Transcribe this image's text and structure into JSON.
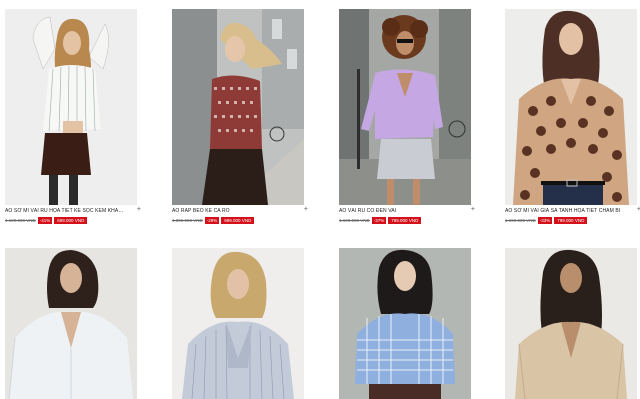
{
  "products": [
    {
      "name": "ÁO SƠ MI VẢI RŨ HỌA TIẾT KẺ SỌC KÈM KHĂN QUÀ...",
      "old_price": "1.199.000 VND",
      "discount": "-41%",
      "price": "699.000 VND"
    },
    {
      "name": "ÁO RÁP BÈO KẺ CA RÔ",
      "old_price": "1.399.000 VND",
      "discount": "-29%",
      "price": "999.000 VND"
    },
    {
      "name": "ÁO VẢI RŨ CỔ ĐÈN VAI",
      "old_price": "1.199.000 VND",
      "discount": "-37%",
      "price": "799.000 VND"
    },
    {
      "name": "ÁO SƠ MI VẢI GIẢ SA TANH HỌA TIẾT CHẤM BI",
      "old_price": "1.199.000 VND",
      "discount": "-33%",
      "price": "799.000 VND"
    },
    {
      "name": "",
      "old_price": "",
      "discount": "",
      "price": ""
    },
    {
      "name": "",
      "old_price": "",
      "discount": "",
      "price": ""
    },
    {
      "name": "",
      "old_price": "",
      "discount": "",
      "price": ""
    },
    {
      "name": "",
      "old_price": "",
      "discount": "",
      "price": ""
    }
  ],
  "ui": {
    "add_symbol": "+"
  },
  "colors": {
    "sale_red": "#d4101b"
  }
}
